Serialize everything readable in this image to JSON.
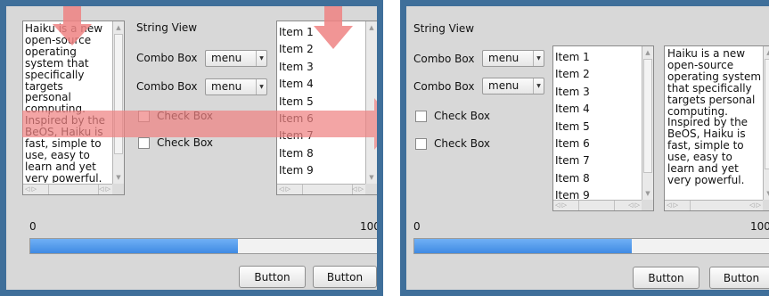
{
  "colors": {
    "frame": "#3f6f9a",
    "window_bg": "#d8d8d8",
    "progress_fill": "#4a90e2",
    "hint_arrow": "#ee8282"
  },
  "text_view": {
    "text": "Haiku is a new open-source operating system that specifically targets personal computing. Inspired by the BeOS, Haiku is fast, simple to use, easy to learn and yet very powerful."
  },
  "string_view": "String View",
  "combo_label": "Combo Box",
  "combo_value": "menu",
  "check_label": "Check Box",
  "list_items": [
    "Item 1",
    "Item 2",
    "Item 3",
    "Item 4",
    "Item 5",
    "Item 6",
    "Item 7",
    "Item 8",
    "Item 9"
  ],
  "progress": {
    "min_label": "0",
    "max_label": "100",
    "value_fraction_left": 0.59,
    "value_fraction_right": 0.59
  },
  "button_label": "Button",
  "hint_icons": [
    "arrow-down-icon",
    "arrow-right-icon"
  ]
}
